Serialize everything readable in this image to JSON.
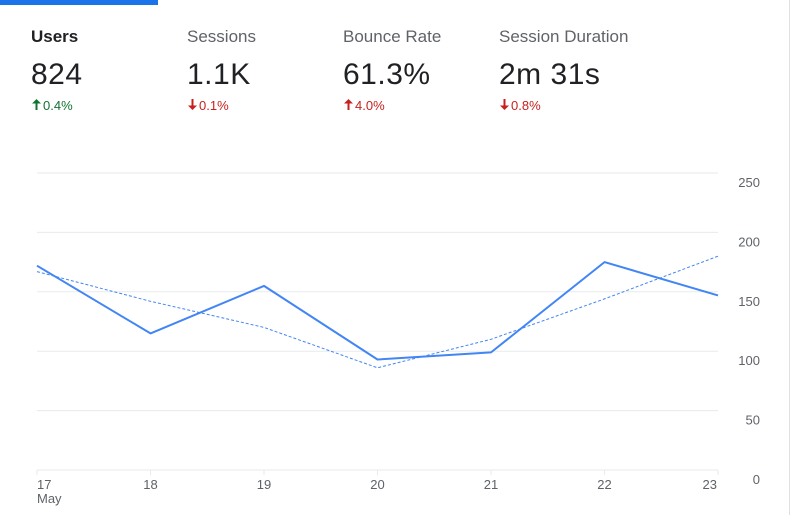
{
  "metrics": [
    {
      "name": "Users",
      "value": "824",
      "change": "0.4%",
      "direction": "up",
      "sentiment": "good",
      "active": true
    },
    {
      "name": "Sessions",
      "value": "1.1K",
      "change": "0.1%",
      "direction": "down",
      "sentiment": "bad",
      "active": false
    },
    {
      "name": "Bounce Rate",
      "value": "61.3%",
      "change": "4.0%",
      "direction": "up",
      "sentiment": "bad",
      "active": false
    },
    {
      "name": "Session Duration",
      "value": "2m 31s",
      "change": "0.8%",
      "direction": "down",
      "sentiment": "bad",
      "active": false
    }
  ],
  "colors": {
    "accent": "#1a73e8",
    "line": "#4285f4",
    "positive": "#137333",
    "negative": "#c5221f",
    "grid": "#e8eaed"
  },
  "chart_data": {
    "type": "line",
    "x": [
      "17",
      "18",
      "19",
      "20",
      "21",
      "22",
      "23"
    ],
    "x_sublabel": "May",
    "y_ticks": [
      0,
      50,
      100,
      150,
      200,
      250
    ],
    "ylim": [
      0,
      250
    ],
    "y_axis_side": "right",
    "grid": true,
    "series": [
      {
        "values": [
          172,
          115,
          155,
          93,
          99,
          175,
          147
        ],
        "style": "solid"
      },
      {
        "values": [
          167,
          142,
          120,
          86,
          110,
          144,
          180
        ],
        "style": "dashed"
      }
    ]
  }
}
